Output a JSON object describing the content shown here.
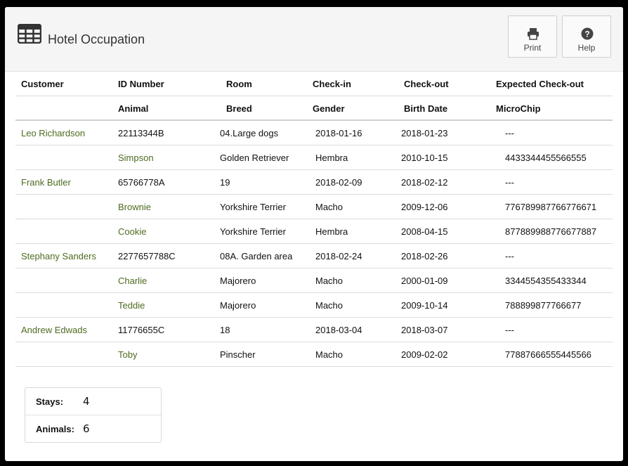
{
  "header": {
    "title": "Hotel Occupation",
    "title_icon": "table-grid-icon",
    "buttons": [
      {
        "label": "Print",
        "icon": "printer-icon"
      },
      {
        "label": "Help",
        "icon": "question-circle-icon"
      }
    ]
  },
  "table": {
    "head1": [
      "Customer",
      "ID Number",
      "Room",
      "Check-in",
      "Check-out",
      "Expected Check-out"
    ],
    "head2": [
      "Animal",
      "Breed",
      "Gender",
      "Birth Date",
      "MicroChip"
    ],
    "rows": [
      {
        "type": "customer",
        "cells": [
          "Leo Richardson",
          "22113344B",
          "04.Large dogs",
          "2018-01-16",
          "2018-01-23",
          "---"
        ]
      },
      {
        "type": "animal",
        "cells": [
          "Simpson",
          "Golden Retriever",
          "Hembra",
          "2010-10-15",
          "4433344455566555"
        ]
      },
      {
        "type": "customer",
        "cells": [
          "Frank Butler",
          "65766778A",
          "19",
          "2018-02-09",
          "2018-02-12",
          "---"
        ]
      },
      {
        "type": "animal",
        "cells": [
          "Brownie",
          "Yorkshire Terrier",
          "Macho",
          "2009-12-06",
          "776789987766776671"
        ]
      },
      {
        "type": "animal",
        "cells": [
          "Cookie",
          "Yorkshire Terrier",
          "Hembra",
          "2008-04-15",
          "877889988776677887"
        ]
      },
      {
        "type": "customer",
        "cells": [
          "Stephany Sanders",
          "2277657788C",
          "08A. Garden area",
          "2018-02-24",
          "2018-02-26",
          "---"
        ]
      },
      {
        "type": "animal",
        "cells": [
          "Charlie",
          "Majorero",
          "Macho",
          "2000-01-09",
          "3344554355433344"
        ]
      },
      {
        "type": "animal",
        "cells": [
          "Teddie",
          "Majorero",
          "Macho",
          "2009-10-14",
          "788899877766677"
        ]
      },
      {
        "type": "customer",
        "cells": [
          "Andrew Edwads",
          "11776655C",
          "18",
          "2018-03-04",
          "2018-03-07",
          "---"
        ]
      },
      {
        "type": "animal",
        "cells": [
          "Toby",
          "Pinscher",
          "Macho",
          "2009-02-02",
          "77887666555445566"
        ]
      }
    ]
  },
  "summary": [
    {
      "label": "Stays:",
      "value": "4"
    },
    {
      "label": "Animals:",
      "value": "6"
    }
  ],
  "colors": {
    "link_green": "#4e6b1f",
    "header_bg": "#f5f5f5"
  }
}
